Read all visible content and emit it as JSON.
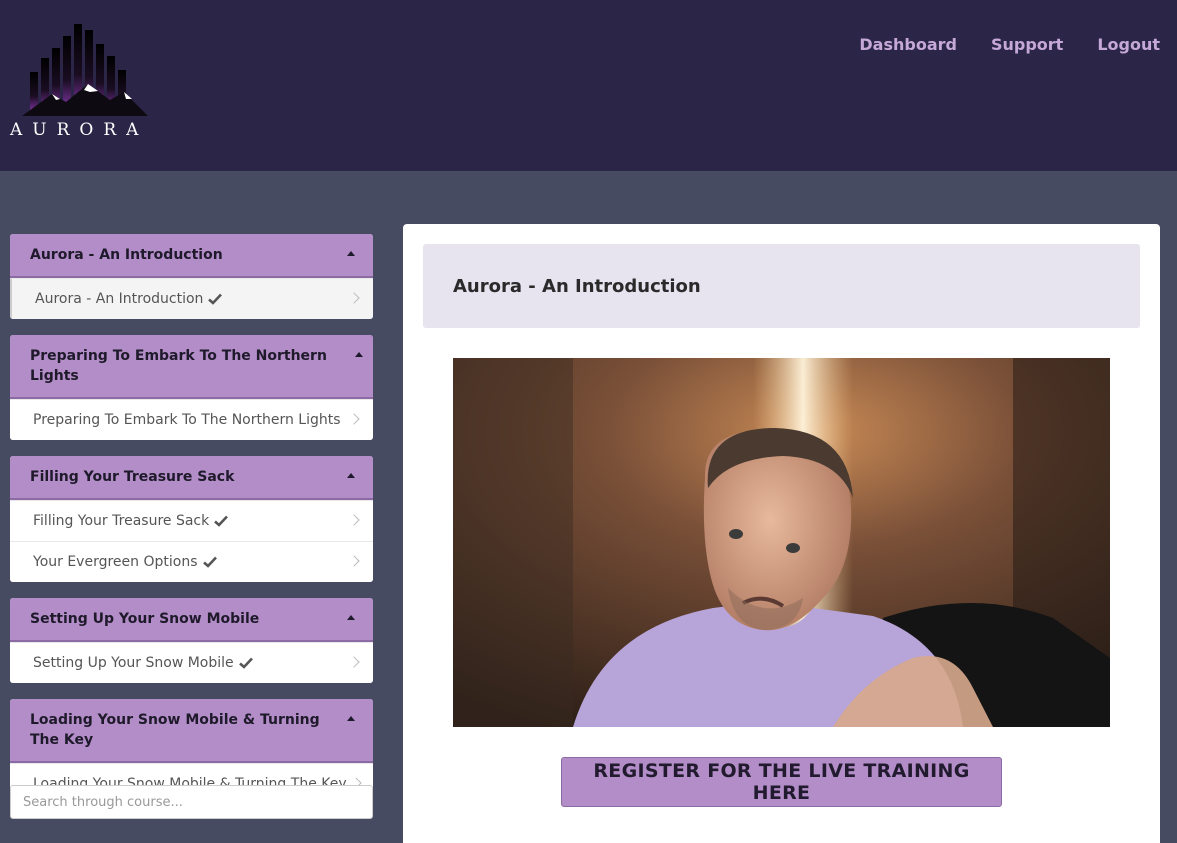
{
  "brand": {
    "logo_text": "AURORA",
    "accent": "#b38dc7",
    "header_bg": "#2b2647"
  },
  "nav": [
    {
      "label": "Dashboard"
    },
    {
      "label": "Support"
    },
    {
      "label": "Logout"
    }
  ],
  "modules": [
    {
      "title": "Aurora - An Introduction",
      "lessons": [
        {
          "label": "Aurora - An Introduction",
          "completed": true,
          "active": true
        }
      ]
    },
    {
      "title": "Preparing To Embark To The Northern Lights",
      "lessons": [
        {
          "label": "Preparing To Embark To The Northern Lights",
          "completed": true
        }
      ]
    },
    {
      "title": "Filling Your Treasure Sack",
      "lessons": [
        {
          "label": "Filling Your Treasure Sack",
          "completed": true
        },
        {
          "label": "Your Evergreen Options",
          "completed": true
        }
      ]
    },
    {
      "title": "Setting Up Your Snow Mobile",
      "lessons": [
        {
          "label": "Setting Up Your Snow Mobile",
          "completed": true
        }
      ]
    },
    {
      "title": "Loading Your Snow Mobile & Turning The Key",
      "lessons": [
        {
          "label": "Loading Your Snow Mobile & Turning The Key",
          "completed": true
        }
      ]
    }
  ],
  "search": {
    "placeholder": "Search through course..."
  },
  "main": {
    "lesson_title": "Aurora - An Introduction",
    "cta_label": "REGISTER FOR THE LIVE TRAINING HERE"
  }
}
